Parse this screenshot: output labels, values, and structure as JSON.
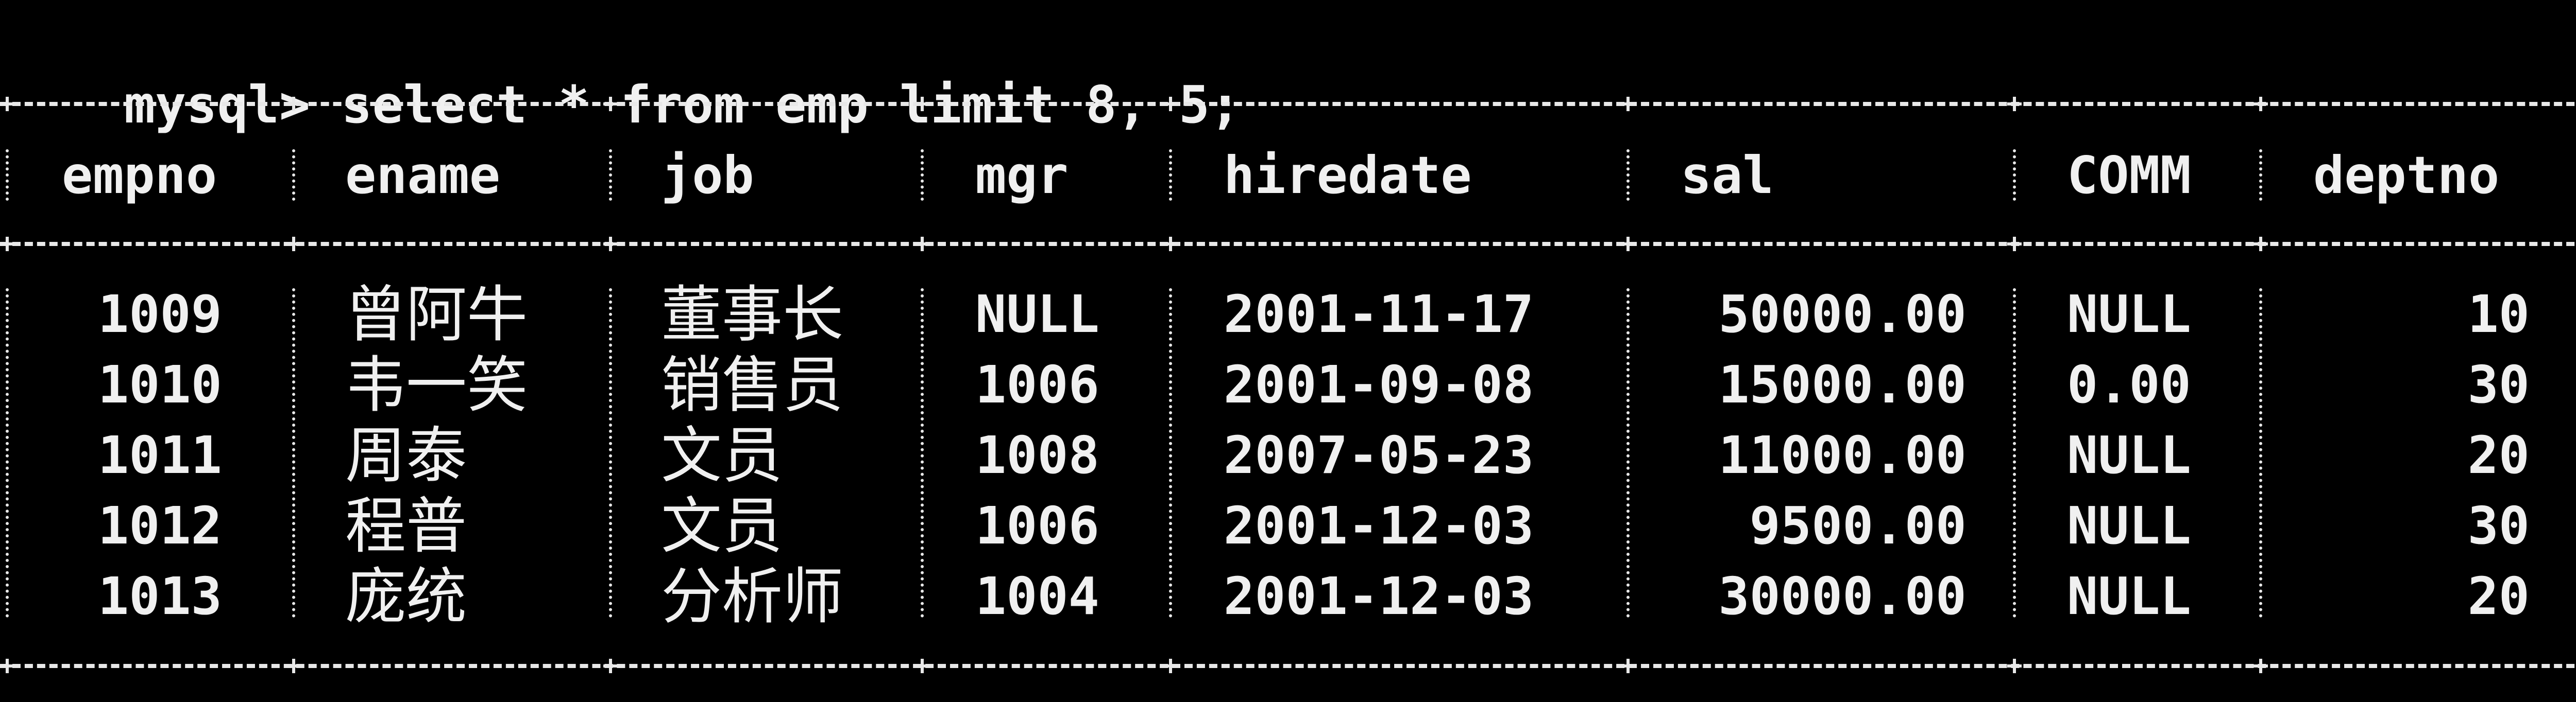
{
  "terminal": {
    "prompt": "mysql>",
    "command": "select * from emp limit 8, 5;"
  },
  "table": {
    "columns": [
      "empno",
      "ename",
      "job",
      "mgr",
      "hiredate",
      "sal",
      "COMM",
      "deptno"
    ],
    "rows": [
      [
        "1009",
        "曾阿牛",
        "董事长",
        "NULL",
        "2001-11-17",
        "50000.00",
        "NULL",
        "10"
      ],
      [
        "1010",
        "韦一笑",
        "销售员",
        "1006",
        "2001-09-08",
        "15000.00",
        "0.00",
        "30"
      ],
      [
        "1011",
        "周泰",
        "文员",
        "1008",
        "2007-05-23",
        "11000.00",
        "NULL",
        "20"
      ],
      [
        "1012",
        "程普",
        "文员",
        "1006",
        "2001-12-03",
        "9500.00",
        "NULL",
        "30"
      ],
      [
        "1013",
        "庞统",
        "分析师",
        "1004",
        "2001-12-03",
        "30000.00",
        "NULL",
        "20"
      ]
    ]
  }
}
